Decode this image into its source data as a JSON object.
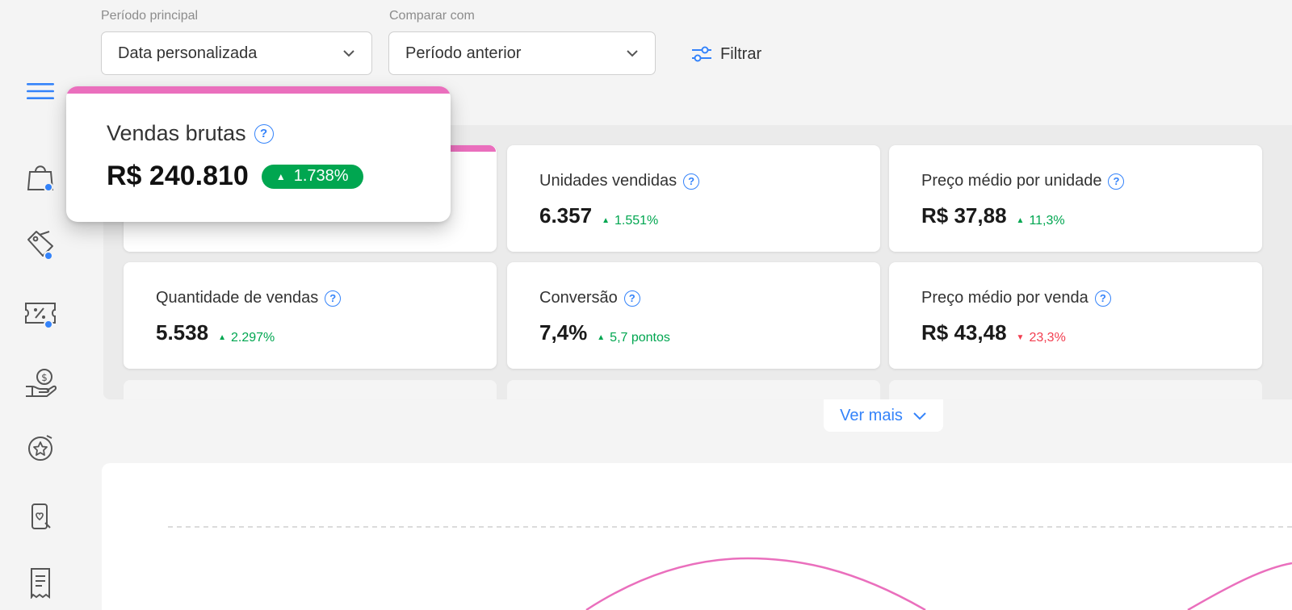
{
  "filters": {
    "primary_label": "Período principal",
    "primary_value": "Data personalizada",
    "compare_label": "Comparar com",
    "compare_value": "Período anterior",
    "filter_label": "Filtrar"
  },
  "highlight": {
    "title": "Vendas brutas",
    "value": "R$ 240.810",
    "delta": "1.738%",
    "delta_direction": "up",
    "accent_color": "#ea6fbd"
  },
  "metrics": [
    {
      "title": "Unidades vendidas",
      "value": "6.357",
      "delta": "1.551%",
      "direction": "up"
    },
    {
      "title": "Preço médio por unidade",
      "value": "R$ 37,88",
      "delta": "11,3%",
      "direction": "up"
    },
    {
      "title": "Quantidade de vendas",
      "value": "5.538",
      "delta": "2.297%",
      "direction": "up"
    },
    {
      "title": "Conversão",
      "value": "7,4%",
      "delta": "5,7 pontos",
      "direction": "up"
    },
    {
      "title": "Preço médio por venda",
      "value": "R$ 43,48",
      "delta": "23,3%",
      "direction": "down"
    }
  ],
  "help_glyph": "?",
  "up_glyph": "▲",
  "down_glyph": "▼",
  "ver_mais": "Ver mais",
  "colors": {
    "brand_blue": "#3483fa",
    "positive": "#00a650",
    "negative": "#f23d4f",
    "series": "#ea6fbd"
  },
  "sidebar_icons": [
    "menu-icon",
    "shopping-bag-icon",
    "tag-icon",
    "coupon-icon",
    "money-hand-icon",
    "star-badge-icon",
    "phone-heart-icon",
    "receipt-icon"
  ]
}
